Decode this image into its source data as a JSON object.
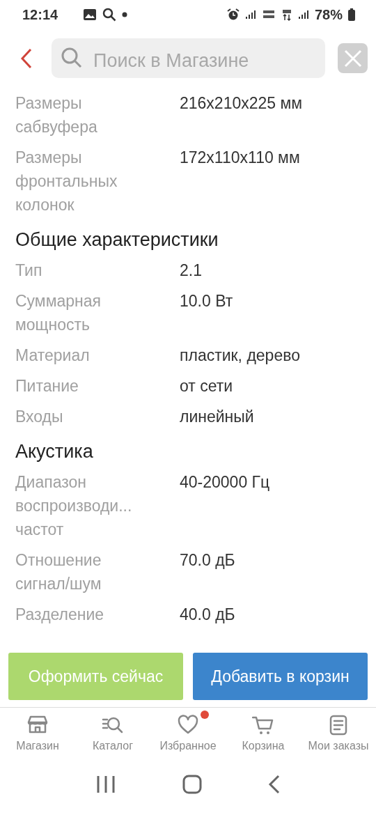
{
  "status_bar": {
    "time": "12:14",
    "battery": "78%"
  },
  "header": {
    "search": {
      "placeholder": "Поиск в Магазине"
    }
  },
  "specs": [
    {
      "kind": "row",
      "label": "Размеры сабвуфера",
      "value": "216x210x225 мм"
    },
    {
      "kind": "row",
      "label": "Размеры фронтальных колонок",
      "value": "172x110x110 мм"
    },
    {
      "kind": "section",
      "label": "Общие характеристики"
    },
    {
      "kind": "row",
      "label": "Тип",
      "value": "2.1"
    },
    {
      "kind": "row",
      "label": "Суммарная мощность",
      "value": "10.0 Вт"
    },
    {
      "kind": "row",
      "label": "Материал",
      "value": "пластик, дерево"
    },
    {
      "kind": "row",
      "label": "Питание",
      "value": "от сети"
    },
    {
      "kind": "row",
      "label": "Входы",
      "value": "линейный"
    },
    {
      "kind": "section",
      "label": "Акустика"
    },
    {
      "kind": "row",
      "label": "Диапазон воспроизводи... частот",
      "value": "40-20000 Гц"
    },
    {
      "kind": "row",
      "label": "Отношение сигнал/шум",
      "value": "70.0 дБ"
    },
    {
      "kind": "row",
      "label": "Разделение",
      "value": "40.0 дБ"
    }
  ],
  "actions": [
    {
      "kind": "buy",
      "label": "Оформить сейчас"
    },
    {
      "kind": "cart",
      "label": "Добавить в корзин"
    }
  ],
  "tab_bar": [
    {
      "kind": "store",
      "label": "Магазин",
      "badge": false
    },
    {
      "kind": "catalog",
      "label": "Каталог",
      "badge": false
    },
    {
      "kind": "heart",
      "label": "Избранное",
      "badge": true
    },
    {
      "kind": "cart",
      "label": "Корзина",
      "badge": false
    },
    {
      "kind": "orders",
      "label": "Мои заказы",
      "badge": false
    }
  ]
}
